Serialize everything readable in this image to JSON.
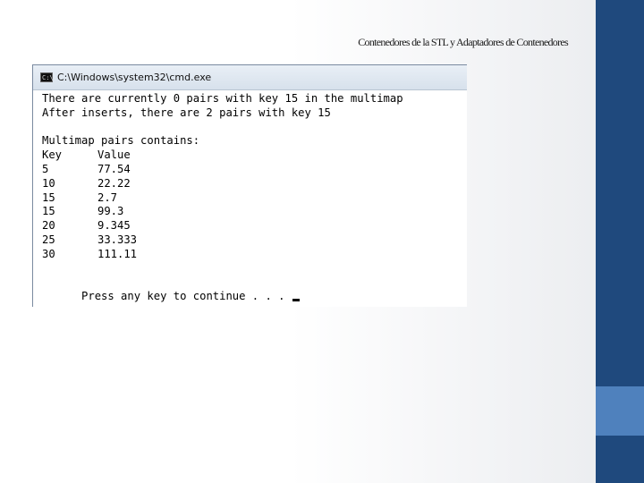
{
  "slide": {
    "title": "Contenedores de la STL y Adaptadores de Contenedores"
  },
  "window": {
    "title": "C:\\Windows\\system32\\cmd.exe",
    "icon": "cmd-icon"
  },
  "console": {
    "line1": "There are currently 0 pairs with key 15 in the multimap",
    "line2": "After inserts, there are 2 pairs with key 15",
    "header": "Multimap pairs contains:",
    "col_key": "Key",
    "col_value": "Value",
    "rows": [
      {
        "key": "5",
        "value": "77.54"
      },
      {
        "key": "10",
        "value": "22.22"
      },
      {
        "key": "15",
        "value": "2.7"
      },
      {
        "key": "15",
        "value": "99.3"
      },
      {
        "key": "20",
        "value": "9.345"
      },
      {
        "key": "25",
        "value": "33.333"
      },
      {
        "key": "30",
        "value": "111.11"
      }
    ],
    "prompt": "Press any key to continue . . ."
  },
  "colors": {
    "bar": "#1f497d",
    "accent": "#4f81bd"
  }
}
